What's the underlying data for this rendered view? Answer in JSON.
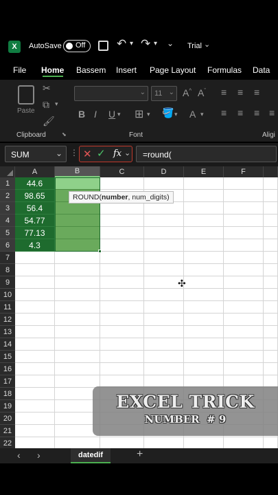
{
  "titlebar": {
    "autosave_label": "AutoSave",
    "toggle_state": "Off",
    "trial_label": "Trial"
  },
  "menu": [
    "File",
    "Home",
    "Bassem",
    "Insert",
    "Page Layout",
    "Formulas",
    "Data"
  ],
  "ribbon": {
    "paste_label": "Paste",
    "font_size": "11",
    "groups": [
      "Clipboard",
      "Font",
      "Aligi"
    ]
  },
  "formula_bar": {
    "name_box": "SUM",
    "fx_label": "fx",
    "formula": "=round("
  },
  "columns": [
    "A",
    "B",
    "C",
    "D",
    "E",
    "F"
  ],
  "rows": [
    "1",
    "2",
    "3",
    "4",
    "5",
    "6",
    "7",
    "8",
    "9",
    "10",
    "11",
    "12",
    "13",
    "14",
    "15",
    "16",
    "17",
    "18",
    "19",
    "20",
    "21",
    "22"
  ],
  "colA_values": [
    "44.6",
    "98.65",
    "56.4",
    "54.77",
    "77.13",
    "4.3"
  ],
  "tooltip": {
    "fn": "ROUND(",
    "arg1": "number",
    "rest": ", num_digits)"
  },
  "overlay": {
    "title": "EXCEL TRICK",
    "subtitle": "NUMBER  # 9"
  },
  "sheet_tab": "datedif",
  "colors": {
    "colA_fill": "#1e6b2e",
    "colB_fill": "#6aaa5c",
    "selected_head": "#8fd18a"
  }
}
